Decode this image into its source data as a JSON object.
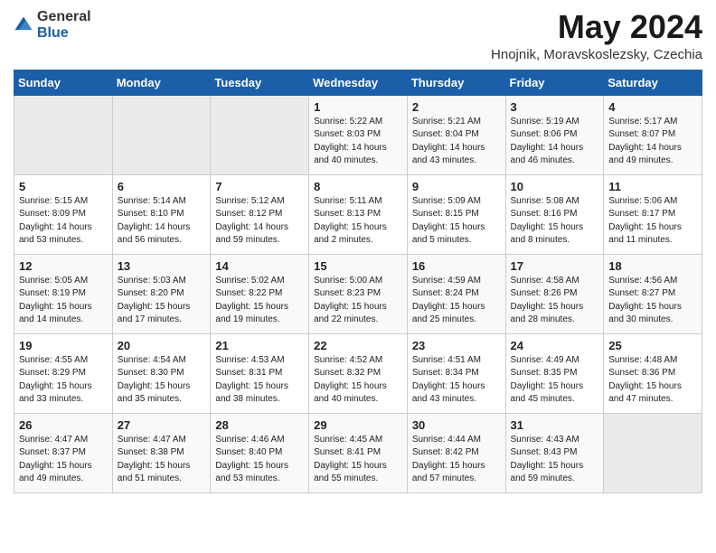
{
  "logo": {
    "general": "General",
    "blue": "Blue"
  },
  "header": {
    "month": "May 2024",
    "location": "Hnojnik, Moravskoslezsky, Czechia"
  },
  "weekdays": [
    "Sunday",
    "Monday",
    "Tuesday",
    "Wednesday",
    "Thursday",
    "Friday",
    "Saturday"
  ],
  "weeks": [
    [
      {
        "day": null
      },
      {
        "day": null
      },
      {
        "day": null
      },
      {
        "day": "1",
        "sunrise": "Sunrise: 5:22 AM",
        "sunset": "Sunset: 8:03 PM",
        "daylight": "Daylight: 14 hours and 40 minutes."
      },
      {
        "day": "2",
        "sunrise": "Sunrise: 5:21 AM",
        "sunset": "Sunset: 8:04 PM",
        "daylight": "Daylight: 14 hours and 43 minutes."
      },
      {
        "day": "3",
        "sunrise": "Sunrise: 5:19 AM",
        "sunset": "Sunset: 8:06 PM",
        "daylight": "Daylight: 14 hours and 46 minutes."
      },
      {
        "day": "4",
        "sunrise": "Sunrise: 5:17 AM",
        "sunset": "Sunset: 8:07 PM",
        "daylight": "Daylight: 14 hours and 49 minutes."
      }
    ],
    [
      {
        "day": "5",
        "sunrise": "Sunrise: 5:15 AM",
        "sunset": "Sunset: 8:09 PM",
        "daylight": "Daylight: 14 hours and 53 minutes."
      },
      {
        "day": "6",
        "sunrise": "Sunrise: 5:14 AM",
        "sunset": "Sunset: 8:10 PM",
        "daylight": "Daylight: 14 hours and 56 minutes."
      },
      {
        "day": "7",
        "sunrise": "Sunrise: 5:12 AM",
        "sunset": "Sunset: 8:12 PM",
        "daylight": "Daylight: 14 hours and 59 minutes."
      },
      {
        "day": "8",
        "sunrise": "Sunrise: 5:11 AM",
        "sunset": "Sunset: 8:13 PM",
        "daylight": "Daylight: 15 hours and 2 minutes."
      },
      {
        "day": "9",
        "sunrise": "Sunrise: 5:09 AM",
        "sunset": "Sunset: 8:15 PM",
        "daylight": "Daylight: 15 hours and 5 minutes."
      },
      {
        "day": "10",
        "sunrise": "Sunrise: 5:08 AM",
        "sunset": "Sunset: 8:16 PM",
        "daylight": "Daylight: 15 hours and 8 minutes."
      },
      {
        "day": "11",
        "sunrise": "Sunrise: 5:06 AM",
        "sunset": "Sunset: 8:17 PM",
        "daylight": "Daylight: 15 hours and 11 minutes."
      }
    ],
    [
      {
        "day": "12",
        "sunrise": "Sunrise: 5:05 AM",
        "sunset": "Sunset: 8:19 PM",
        "daylight": "Daylight: 15 hours and 14 minutes."
      },
      {
        "day": "13",
        "sunrise": "Sunrise: 5:03 AM",
        "sunset": "Sunset: 8:20 PM",
        "daylight": "Daylight: 15 hours and 17 minutes."
      },
      {
        "day": "14",
        "sunrise": "Sunrise: 5:02 AM",
        "sunset": "Sunset: 8:22 PM",
        "daylight": "Daylight: 15 hours and 19 minutes."
      },
      {
        "day": "15",
        "sunrise": "Sunrise: 5:00 AM",
        "sunset": "Sunset: 8:23 PM",
        "daylight": "Daylight: 15 hours and 22 minutes."
      },
      {
        "day": "16",
        "sunrise": "Sunrise: 4:59 AM",
        "sunset": "Sunset: 8:24 PM",
        "daylight": "Daylight: 15 hours and 25 minutes."
      },
      {
        "day": "17",
        "sunrise": "Sunrise: 4:58 AM",
        "sunset": "Sunset: 8:26 PM",
        "daylight": "Daylight: 15 hours and 28 minutes."
      },
      {
        "day": "18",
        "sunrise": "Sunrise: 4:56 AM",
        "sunset": "Sunset: 8:27 PM",
        "daylight": "Daylight: 15 hours and 30 minutes."
      }
    ],
    [
      {
        "day": "19",
        "sunrise": "Sunrise: 4:55 AM",
        "sunset": "Sunset: 8:29 PM",
        "daylight": "Daylight: 15 hours and 33 minutes."
      },
      {
        "day": "20",
        "sunrise": "Sunrise: 4:54 AM",
        "sunset": "Sunset: 8:30 PM",
        "daylight": "Daylight: 15 hours and 35 minutes."
      },
      {
        "day": "21",
        "sunrise": "Sunrise: 4:53 AM",
        "sunset": "Sunset: 8:31 PM",
        "daylight": "Daylight: 15 hours and 38 minutes."
      },
      {
        "day": "22",
        "sunrise": "Sunrise: 4:52 AM",
        "sunset": "Sunset: 8:32 PM",
        "daylight": "Daylight: 15 hours and 40 minutes."
      },
      {
        "day": "23",
        "sunrise": "Sunrise: 4:51 AM",
        "sunset": "Sunset: 8:34 PM",
        "daylight": "Daylight: 15 hours and 43 minutes."
      },
      {
        "day": "24",
        "sunrise": "Sunrise: 4:49 AM",
        "sunset": "Sunset: 8:35 PM",
        "daylight": "Daylight: 15 hours and 45 minutes."
      },
      {
        "day": "25",
        "sunrise": "Sunrise: 4:48 AM",
        "sunset": "Sunset: 8:36 PM",
        "daylight": "Daylight: 15 hours and 47 minutes."
      }
    ],
    [
      {
        "day": "26",
        "sunrise": "Sunrise: 4:47 AM",
        "sunset": "Sunset: 8:37 PM",
        "daylight": "Daylight: 15 hours and 49 minutes."
      },
      {
        "day": "27",
        "sunrise": "Sunrise: 4:47 AM",
        "sunset": "Sunset: 8:38 PM",
        "daylight": "Daylight: 15 hours and 51 minutes."
      },
      {
        "day": "28",
        "sunrise": "Sunrise: 4:46 AM",
        "sunset": "Sunset: 8:40 PM",
        "daylight": "Daylight: 15 hours and 53 minutes."
      },
      {
        "day": "29",
        "sunrise": "Sunrise: 4:45 AM",
        "sunset": "Sunset: 8:41 PM",
        "daylight": "Daylight: 15 hours and 55 minutes."
      },
      {
        "day": "30",
        "sunrise": "Sunrise: 4:44 AM",
        "sunset": "Sunset: 8:42 PM",
        "daylight": "Daylight: 15 hours and 57 minutes."
      },
      {
        "day": "31",
        "sunrise": "Sunrise: 4:43 AM",
        "sunset": "Sunset: 8:43 PM",
        "daylight": "Daylight: 15 hours and 59 minutes."
      },
      {
        "day": null
      }
    ]
  ]
}
